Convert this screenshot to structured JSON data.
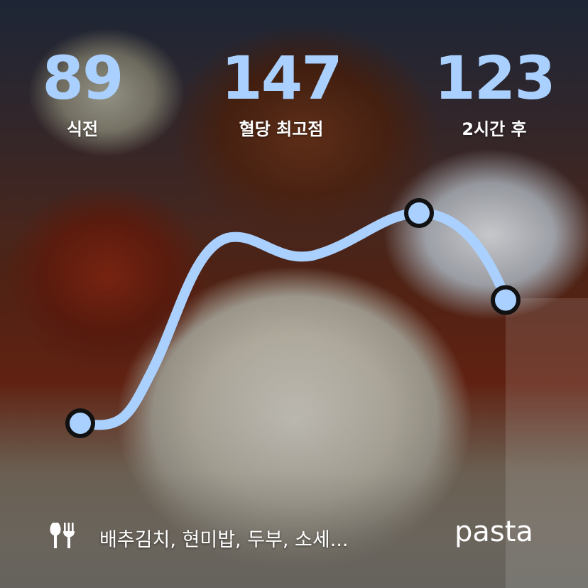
{
  "stats": {
    "before": {
      "value": "89",
      "label": "식전"
    },
    "peak": {
      "value": "147",
      "label": "혈당 최고점"
    },
    "after": {
      "value": "123",
      "label": "2시간 후"
    }
  },
  "footer": {
    "meal_icon": "fork-knife-icon",
    "meal_text": "배추김치, 현미밥, 두부, 소세...",
    "brand": "pasta"
  },
  "colors": {
    "accent": "#a9d0ff",
    "text": "#ffffff",
    "marker_stroke": "#111111"
  },
  "chart_data": {
    "type": "line",
    "series": [
      {
        "values": [
          89,
          147,
          123
        ]
      }
    ]
  }
}
